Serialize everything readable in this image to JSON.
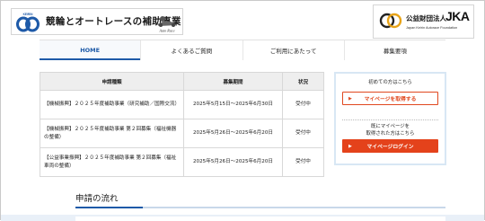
{
  "header": {
    "logo_title": "競輪とオートレースの補助事業",
    "keirin_mark_text": "KEIRIN",
    "autorace_mark_text": "Auto Race",
    "jka_org_name": "公益財団法人",
    "jka_letters": "JKA",
    "jka_sub": "Japan Keirin Autorace Foundation"
  },
  "nav": {
    "items": [
      {
        "label": "HOME"
      },
      {
        "label": "よくあるご質問"
      },
      {
        "label": "ご利用にあたって"
      },
      {
        "label": "募集要項"
      }
    ]
  },
  "table": {
    "headers": [
      "申請種類",
      "募集期間",
      "状況"
    ],
    "rows": [
      {
        "name": "【機械振興】２０２５年度補助事業（研究補助／国際交流）",
        "period": "2025年5月15日～2025年6月30日",
        "status": "受付中"
      },
      {
        "name": "【機械振興】２０２５年度補助事業 第２回募集（福祉機器の整備）",
        "period": "2025年5月26日～2025年6月20日",
        "status": "受付中"
      },
      {
        "name": "【公益事業振興】２０２５年度補助事業 第２回募集（福祉車両の整備）",
        "period": "2025年5月26日～2025年6月20日",
        "status": "受付中"
      }
    ]
  },
  "side": {
    "first_time_text": "初めての方はこちら",
    "register_button": "マイページを取得する",
    "existing_line1": "既にマイページを",
    "existing_line2": "取得された方はこちら",
    "login_button": "マイページログイン"
  },
  "flow": {
    "title": "申請の流れ"
  },
  "colors": {
    "accent_blue": "#1e5aa8",
    "accent_orange": "#e4421b"
  }
}
